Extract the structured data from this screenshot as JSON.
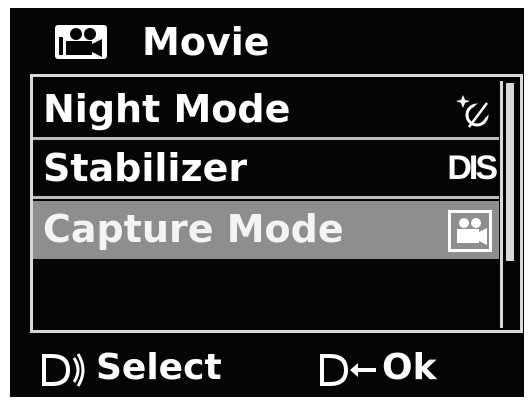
{
  "header": {
    "title": "Movie",
    "icon": "movie-camera-icon"
  },
  "menu": {
    "items": [
      {
        "label": "Night Mode",
        "value_icon": "night-mode-icon"
      },
      {
        "label": "Stabilizer",
        "value_text": "DIS"
      },
      {
        "label": "Capture Mode",
        "value_icon": "movie-camera-icon",
        "selected": true
      }
    ]
  },
  "footer": {
    "select_icon": "dial-icon",
    "select_label": "Select",
    "ok_icon": "shutter-arrow-icon",
    "ok_label": "Ok"
  },
  "colors": {
    "screen_bg": "#050505",
    "text": "#ffffff",
    "highlight": "#8e8e8e",
    "border": "#d8d8d8"
  }
}
